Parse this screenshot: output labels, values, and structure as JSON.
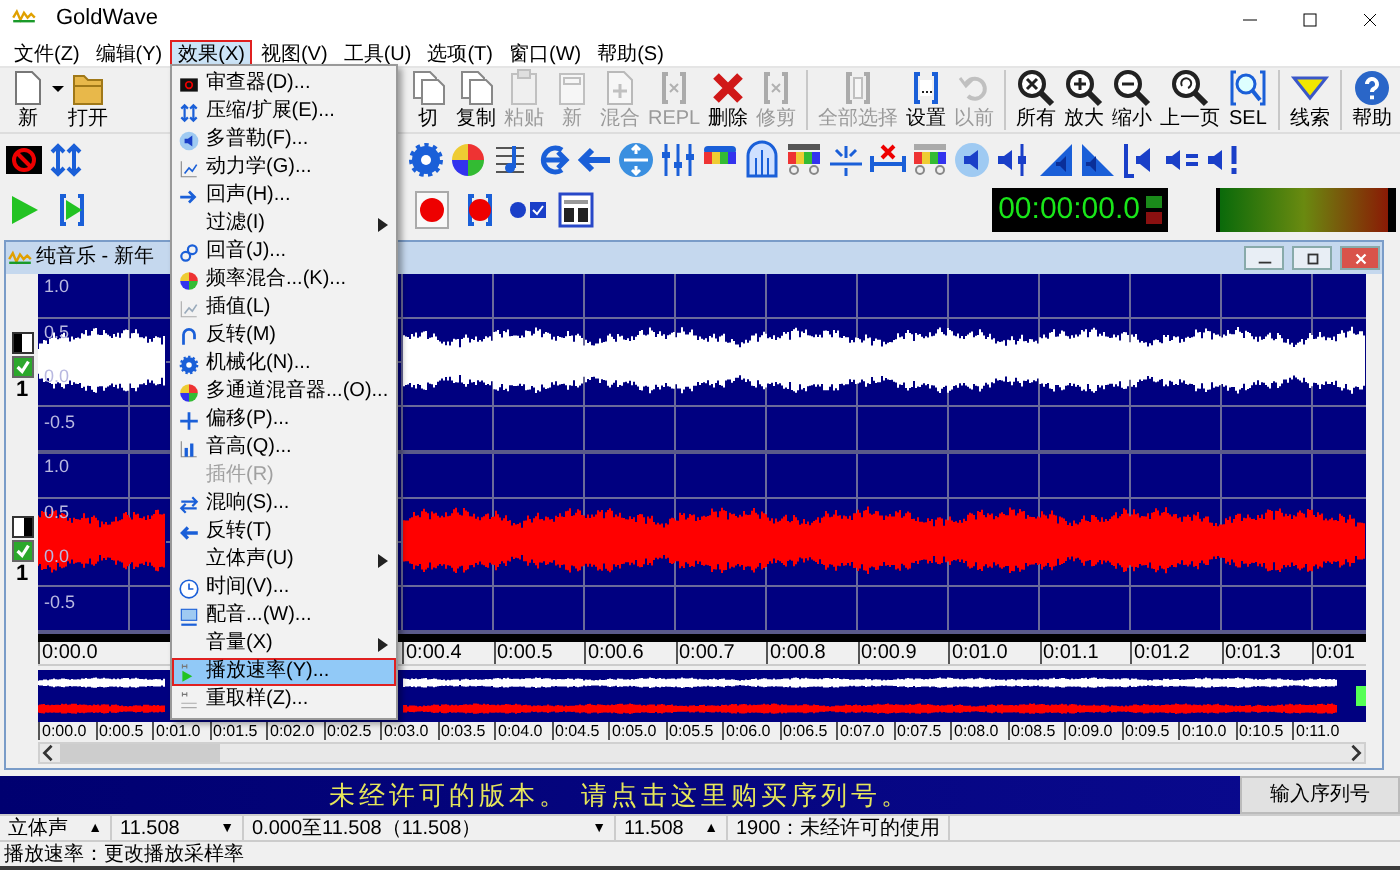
{
  "window": {
    "title": "GoldWave"
  },
  "menu_bar": [
    {
      "label": "文件(Z)",
      "selected": false
    },
    {
      "label": "编辑(Y)",
      "selected": false
    },
    {
      "label": "效果(X)",
      "selected": true
    },
    {
      "label": "视图(V)",
      "selected": false
    },
    {
      "label": "工具(U)",
      "selected": false
    },
    {
      "label": "选项(T)",
      "selected": false
    },
    {
      "label": "窗口(W)",
      "selected": false
    },
    {
      "label": "帮助(S)",
      "selected": false
    }
  ],
  "toolbar_groups": [
    {
      "buttons": [
        {
          "label": "新",
          "disabled": false
        },
        {
          "label": "打开",
          "disabled": false
        }
      ]
    },
    {
      "buttons": [
        {
          "label": "切",
          "disabled": false
        },
        {
          "label": "复制",
          "disabled": false
        },
        {
          "label": "粘贴",
          "disabled": true
        },
        {
          "label": "新",
          "disabled": true
        },
        {
          "label": "混合",
          "disabled": true
        },
        {
          "label": "REPL",
          "disabled": true
        },
        {
          "label": "删除",
          "disabled": false
        },
        {
          "label": "修剪",
          "disabled": true
        }
      ]
    },
    {
      "buttons": [
        {
          "label": "全部选择",
          "disabled": true
        },
        {
          "label": "设置",
          "disabled": false
        },
        {
          "label": "以前",
          "disabled": true
        }
      ]
    },
    {
      "buttons": [
        {
          "label": "所有",
          "disabled": false
        },
        {
          "label": "放大",
          "disabled": false
        },
        {
          "label": "缩小",
          "disabled": false
        },
        {
          "label": "上一页",
          "disabled": false
        },
        {
          "label": "SEL",
          "disabled": false
        }
      ]
    },
    {
      "buttons": [
        {
          "label": "线索",
          "disabled": false
        }
      ]
    },
    {
      "buttons": [
        {
          "label": "帮助",
          "disabled": false
        }
      ]
    }
  ],
  "timer": "00:00:00.0",
  "document": {
    "title": "纯音乐 - 新年",
    "channels": [
      {
        "label": "1",
        "enabled": true,
        "color": "#ffffff",
        "amplitude_labels": [
          "1.0",
          "0.5",
          "0.0",
          "-0.5"
        ]
      },
      {
        "label": "1",
        "enabled": true,
        "color": "#ff0000",
        "amplitude_labels": [
          "1.0",
          "0.5",
          "0.0",
          "-0.5"
        ]
      }
    ],
    "time_ruler": [
      "0:00.0",
      "0:00.4",
      "0:00.5",
      "0:00.6",
      "0:00.7",
      "0:00.8",
      "0:00.9",
      "0:01.0",
      "0:01.1",
      "0:01.2",
      "0:01.3",
      "0:01"
    ],
    "overview_ruler": [
      "0:00.0",
      "0:00.5",
      "0:01.0",
      "0:01.5",
      "0:02.0",
      "0:02.5",
      "0:03.0",
      "0:03.5",
      "0:04.0",
      "0:04.5",
      "0:05.0",
      "0:05.5",
      "0:06.0",
      "0:06.5",
      "0:07.0",
      "0:07.5",
      "0:08.0",
      "0:08.5",
      "0:09.0",
      "0:09.5",
      "0:10.0",
      "0:10.5",
      "0:11.0"
    ]
  },
  "effects_menu": [
    {
      "label": "审查器(D)...",
      "disabled": false,
      "submenu": false,
      "selected": false
    },
    {
      "label": "压缩/扩展(E)...",
      "disabled": false,
      "submenu": false,
      "selected": false
    },
    {
      "label": "多普勒(F)...",
      "disabled": false,
      "submenu": false,
      "selected": false
    },
    {
      "label": "动力学(G)...",
      "disabled": false,
      "submenu": false,
      "selected": false
    },
    {
      "label": "回声(H)...",
      "disabled": false,
      "submenu": false,
      "selected": false
    },
    {
      "label": "过滤(I)",
      "disabled": false,
      "submenu": true,
      "selected": false
    },
    {
      "label": "回音(J)...",
      "disabled": false,
      "submenu": false,
      "selected": false
    },
    {
      "label": "频率混合...(K)...",
      "disabled": false,
      "submenu": false,
      "selected": false
    },
    {
      "label": "插值(L)",
      "disabled": false,
      "submenu": false,
      "selected": false
    },
    {
      "label": "反转(M)",
      "disabled": false,
      "submenu": false,
      "selected": false
    },
    {
      "label": "机械化(N)...",
      "disabled": false,
      "submenu": false,
      "selected": false
    },
    {
      "label": "多通道混音器...(O)...",
      "disabled": false,
      "submenu": false,
      "selected": false
    },
    {
      "label": "偏移(P)...",
      "disabled": false,
      "submenu": false,
      "selected": false
    },
    {
      "label": "音高(Q)...",
      "disabled": false,
      "submenu": false,
      "selected": false
    },
    {
      "label": "插件(R)",
      "disabled": true,
      "submenu": false,
      "selected": false
    },
    {
      "label": "混响(S)...",
      "disabled": false,
      "submenu": false,
      "selected": false
    },
    {
      "label": "反转(T)",
      "disabled": false,
      "submenu": false,
      "selected": false
    },
    {
      "label": "立体声(U)",
      "disabled": false,
      "submenu": true,
      "selected": false
    },
    {
      "label": "时间(V)...",
      "disabled": false,
      "submenu": false,
      "selected": false
    },
    {
      "label": "配音...(W)...",
      "disabled": false,
      "submenu": false,
      "selected": false
    },
    {
      "label": "音量(X)",
      "disabled": false,
      "submenu": true,
      "selected": false
    },
    {
      "label": "播放速率(Y)...",
      "disabled": false,
      "submenu": false,
      "selected": true
    },
    {
      "label": "重取样(Z)...",
      "disabled": false,
      "submenu": false,
      "selected": false
    }
  ],
  "banner": {
    "text": "未经许可的版本。 请点击这里购买序列号。",
    "button": "输入序列号"
  },
  "status_bar": [
    {
      "text": "立体声",
      "arrow": "▲"
    },
    {
      "text": "11.508",
      "arrow": "▼"
    },
    {
      "text": "0.000至11.508（11.508）",
      "arrow": "▼"
    },
    {
      "text": "11.508",
      "arrow": "▲"
    },
    {
      "text": "1900：未经许可的使用"
    }
  ],
  "hint": "播放速率：更改播放采样率"
}
